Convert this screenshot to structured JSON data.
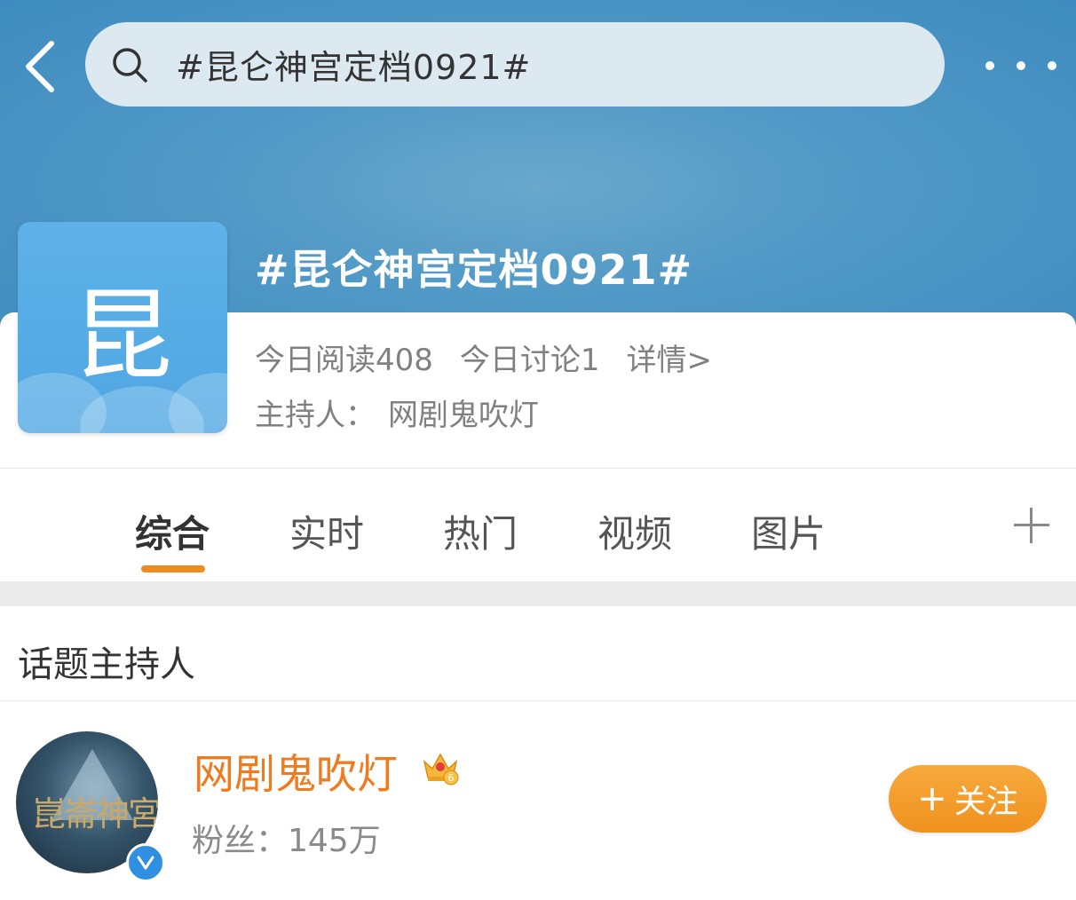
{
  "header": {
    "search_query": "#昆仑神宫定档0921#",
    "topic_title": "#昆仑神宫定档0921#"
  },
  "topic": {
    "avatar_char": "昆",
    "reads_today": "今日阅读408",
    "discussions_today": "今日讨论1",
    "detail_link": "详情>",
    "host_label": "主持人：",
    "host_name": "网剧鬼吹灯"
  },
  "tabs": [
    "综合",
    "实时",
    "热门",
    "视频",
    "图片"
  ],
  "active_tab": "综合",
  "host_section": {
    "title": "话题主持人",
    "name": "网剧鬼吹灯",
    "fans": "粉丝：145万",
    "follow_label": "关注",
    "avatar_text": "崑崙神宮",
    "crown_level": "6"
  },
  "colors": {
    "header_blue": "#4f98c6",
    "accent_orange": "#f08a1c",
    "host_name_orange": "#f07a1e",
    "verified_blue": "#2f8fe0"
  }
}
